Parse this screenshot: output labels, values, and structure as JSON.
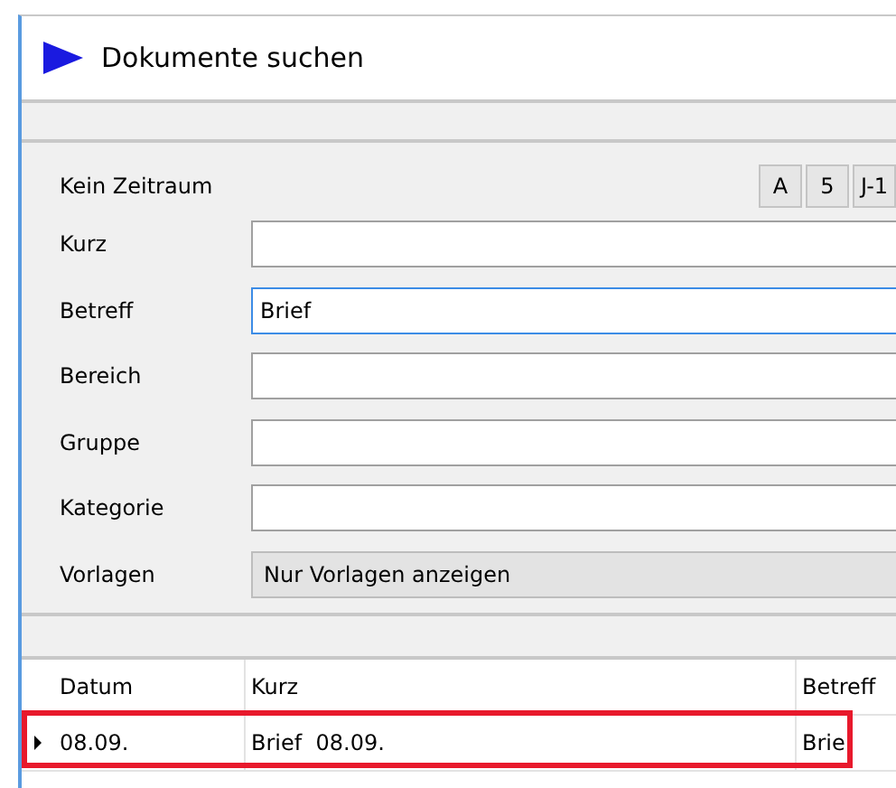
{
  "window": {
    "title": "Dokumente suchen"
  },
  "period": {
    "label": "Kein Zeitraum",
    "buttons": [
      "A",
      "5",
      "J-1"
    ]
  },
  "fields": [
    {
      "label": "Kurz",
      "kind": "text"
    },
    {
      "label": "Betreff",
      "kind": "text",
      "value": "Brief",
      "focused": true
    },
    {
      "label": "Bereich",
      "kind": "text"
    },
    {
      "label": "Gruppe",
      "kind": "text"
    },
    {
      "label": "Kategorie",
      "kind": "text"
    },
    {
      "label": "Vorlagen",
      "kind": "select",
      "value": "Nur Vorlagen anzeigen"
    }
  ],
  "table": {
    "columns": [
      "Datum",
      "Kurz",
      "Betreff"
    ],
    "rows": [
      {
        "cells": [
          "08.09.",
          "Brief  08.09.",
          "Brie"
        ],
        "current": true,
        "highlighted": true
      }
    ]
  }
}
